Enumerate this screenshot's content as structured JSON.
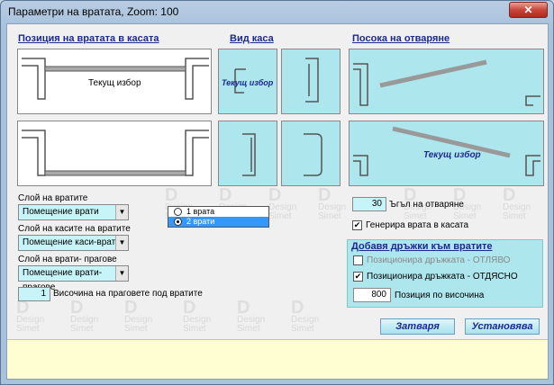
{
  "window": {
    "title": "Параметри на вратата,  Zoom:  100",
    "close_glyph": "✕"
  },
  "sections": {
    "position": "Позиция на вратата в касата",
    "frame_view": "Вид каса",
    "opening_direction": "Посока на отваряне"
  },
  "previews": {
    "current_choice": "Текущ избор"
  },
  "watermark": {
    "mark": "D",
    "line1": "Design",
    "line2": "Simet"
  },
  "layers": {
    "doors_label": "Слой на вратите",
    "doors_value": "Помещение врати",
    "frames_label": "Слой на касите на вратите",
    "frames_value": "Помещение каси-врати",
    "thresholds_label": "Слой на врати- прагове",
    "thresholds_value": "Помещение врати- прагове"
  },
  "threshold_height": {
    "value": "1",
    "label": "Височина на праговете под вратите"
  },
  "door_count": {
    "options": [
      "1 врата",
      "2 врати"
    ],
    "selected_index": 1
  },
  "angle": {
    "value": "30",
    "label": "Ъгъл на отваряне"
  },
  "generate": {
    "checked": true,
    "label": "Генерира врата в касата"
  },
  "handles": {
    "title": "Добавя дръжки към вратите",
    "left": {
      "checked": false,
      "label": "Позиционира дръжката - ОТЛЯВО"
    },
    "right": {
      "checked": true,
      "label": "Позиционира дръжката - ОТДЯСНО"
    },
    "height_value": "800",
    "height_label": "Позиция по височина"
  },
  "buttons": {
    "close": "Затваря",
    "apply": "Установява"
  },
  "colors": {
    "accent": "#1c2a8c",
    "field_bg": "#c7f4f8",
    "preview_bg": "#aee6ee",
    "footer_bg": "#fefed2"
  }
}
